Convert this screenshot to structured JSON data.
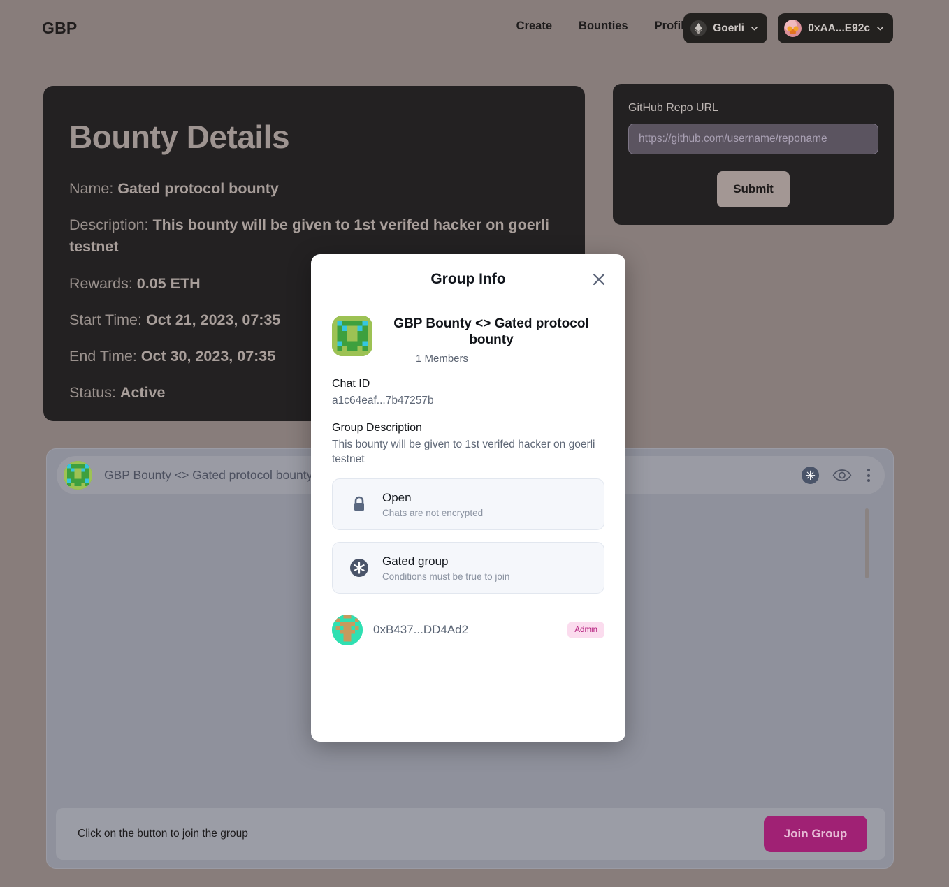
{
  "nav": {
    "brand": "GBP",
    "links": [
      {
        "label": "Create",
        "name": "nav-link-create"
      },
      {
        "label": "Bounties",
        "name": "nav-link-bounties"
      },
      {
        "label": "Profile",
        "name": "nav-link-profile"
      }
    ],
    "chain": {
      "label": "Goerli",
      "icon": "ethereum-icon",
      "chevron": "chevron-down-icon"
    },
    "account": {
      "label": "0xAA...E92c",
      "icon": "avatar",
      "chevron": "chevron-down-icon"
    }
  },
  "bounty": {
    "title": "Bounty Details",
    "fields": [
      {
        "label": "Name:",
        "value": "Gated protocol bounty"
      },
      {
        "label": "Description:",
        "value": "This bounty will be given to 1st verifed hacker on goerli testnet"
      },
      {
        "label": "Rewards:",
        "value": "0.05 ETH"
      },
      {
        "label": "Start Time:",
        "value": "Oct 21, 2023, 07:35"
      },
      {
        "label": "End Time:",
        "value": "Oct 30, 2023, 07:35"
      },
      {
        "label": "Status:",
        "value": "Active"
      }
    ]
  },
  "repo": {
    "label": "GitHub Repo URL",
    "input_value": "",
    "placeholder": "https://github.com/username/reponame",
    "submit_label": "Submit"
  },
  "chat": {
    "header_title": "GBP Bounty <> Gated protocol bounty",
    "actions": [
      {
        "name": "gated-group-icon",
        "glyph": "✳"
      },
      {
        "name": "eye-icon"
      },
      {
        "name": "kebab-menu-icon"
      }
    ],
    "join_text": "Click on the button to join the group",
    "join_button": "Join Group"
  },
  "modal": {
    "title": "Group Info",
    "close_icon": "close-icon",
    "group_name": "GBP Bounty <> Gated protocol bounty",
    "members_count": "1 Members",
    "chat_id_label": "Chat ID",
    "chat_id_value": "a1c64eaf...7b47257b",
    "description_label": "Group Description",
    "description_value": "This bounty will be given to 1st verifed hacker on goerli testnet",
    "options": [
      {
        "title": "Open",
        "subtitle": "Chats are not encrypted",
        "icon": "lock-icon"
      },
      {
        "title": "Gated group",
        "subtitle": "Conditions must be true to join",
        "icon": "asterisk-badge-icon"
      }
    ],
    "members": [
      {
        "address": "0xB437...DD4Ad2",
        "role": "Admin"
      }
    ]
  },
  "colors": {
    "page_bg": "#887d7b",
    "card_bg": "#232122",
    "chat_bg": "#8f919c",
    "accent_join": "#a02174",
    "admin_badge_bg": "#fbdcee",
    "admin_badge_fg": "#b51f7e"
  }
}
